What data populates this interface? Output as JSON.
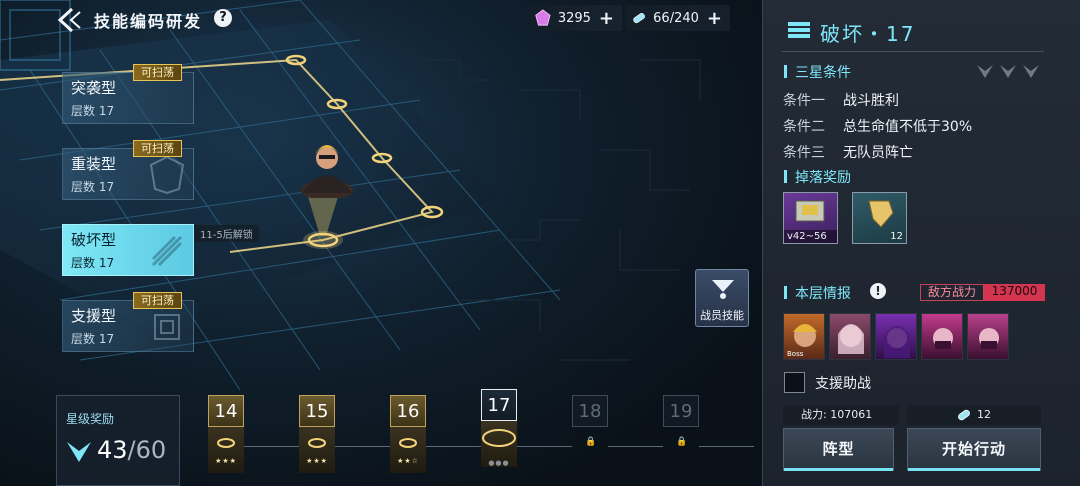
{
  "header": {
    "title": "技能编码研发",
    "help_symbol": "?",
    "crystals": "3295",
    "energy": "66/240",
    "plus": "+"
  },
  "categories": [
    {
      "name": "突袭型",
      "floor": "层数 17",
      "sweep": "可扫荡",
      "active": false
    },
    {
      "name": "重装型",
      "floor": "层数 17",
      "sweep": "可扫荡",
      "active": false
    },
    {
      "name": "破坏型",
      "floor": "层数 17",
      "sweep": "",
      "active": true
    },
    {
      "name": "支援型",
      "floor": "层数 17",
      "sweep": "可扫荡",
      "active": false
    }
  ],
  "unlock_hint": "11-5后解锁",
  "crew_skill": "战员技能",
  "star_reward": {
    "label": "星级奖励",
    "current": "43",
    "total": "/60"
  },
  "floors": [
    {
      "num": "14",
      "state": "cleared",
      "stars": "★★★"
    },
    {
      "num": "15",
      "state": "cleared",
      "stars": "★★★"
    },
    {
      "num": "16",
      "state": "cleared",
      "stars": "★★☆"
    },
    {
      "num": "17",
      "state": "current",
      "stars": "●●●"
    },
    {
      "num": "18",
      "state": "locked",
      "stars": ""
    },
    {
      "num": "19",
      "state": "locked",
      "stars": ""
    }
  ],
  "lock_symbol": "🔒",
  "panel": {
    "stage_title": "破坏・17",
    "conditions_title": "三星条件",
    "conditions": [
      {
        "k": "条件一",
        "v": "战斗胜利"
      },
      {
        "k": "条件二",
        "v": "总生命值不低于30%"
      },
      {
        "k": "条件三",
        "v": "无队员阵亡"
      }
    ],
    "drops_title": "掉落奖励",
    "drops": [
      {
        "caption": "v42~56",
        "qty": ""
      },
      {
        "caption": "",
        "qty": "12"
      }
    ],
    "intel_title": "本层情报",
    "enemy_power_label": "敌方战力",
    "enemy_power": "137000",
    "boss_tag": "Boss",
    "support_label": "支援助战",
    "my_power": "战力: 107061",
    "cost": "12",
    "formation_btn": "阵型",
    "start_btn": "开始行动"
  },
  "colors": {
    "accent": "#7ee6f7",
    "gold": "#e7c255",
    "enemy": "#d3344f"
  }
}
